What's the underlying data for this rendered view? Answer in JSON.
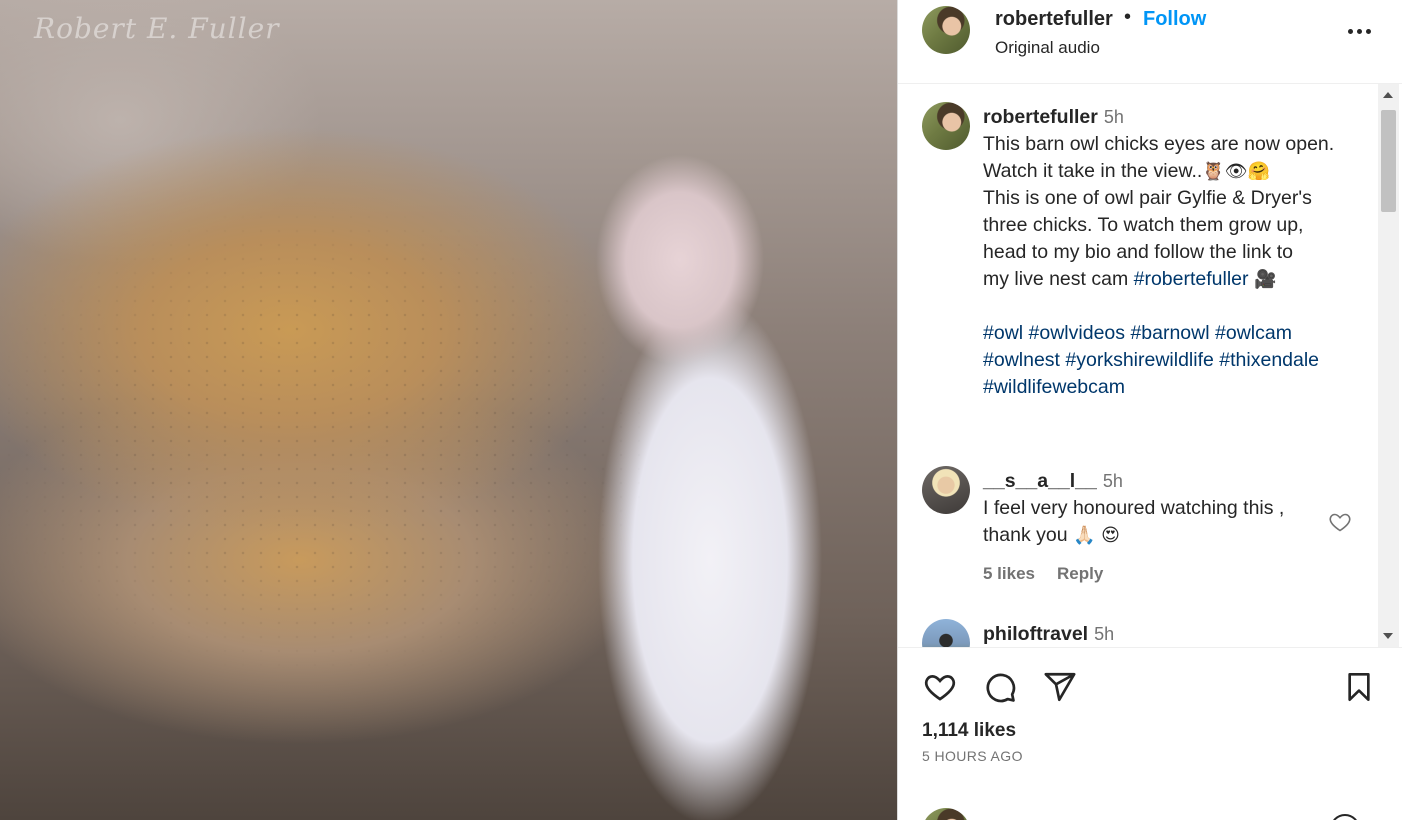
{
  "post": {
    "watermark": "Robert E. Fuller",
    "author": "robertefuller",
    "separator": "•",
    "follow_label": "Follow",
    "audio": "Original audio"
  },
  "caption": {
    "username": "robertefuller",
    "time": "5h",
    "line1": "This barn owl chicks eyes are now open.",
    "line2_text": "Watch it take in the view..",
    "line2_emoji": "🦉👁🤗",
    "line3": "This is one of owl pair Gylfie & Dryer's",
    "line4": "three chicks. To watch them grow up,",
    "line5": "head to my bio and follow the link to",
    "line6_text": "my live nest cam",
    "line6_tag": "#robertefuller",
    "line6_emoji": "🎥",
    "hashtags": [
      "#owl",
      "#owlvideos",
      "#barnowl",
      "#owlcam",
      "#owlnest",
      "#yorkshirewildlife",
      "#thixendale",
      "#wildlifewebcam"
    ]
  },
  "comments": [
    {
      "username": "__s__a__l__",
      "time": "5h",
      "line1": "I feel very honoured watching this ,",
      "line2": "thank you",
      "line2_emoji": "🙏🏻 😍",
      "likes": "5 likes",
      "reply_label": "Reply"
    },
    {
      "username": "philoftravel",
      "time": "5h"
    }
  ],
  "actions": {
    "likes": "1,114 likes",
    "ago": "5 HOURS AGO"
  },
  "icons": [
    "more-icon",
    "heart-icon",
    "comment-icon",
    "share-icon",
    "bookmark-icon"
  ]
}
